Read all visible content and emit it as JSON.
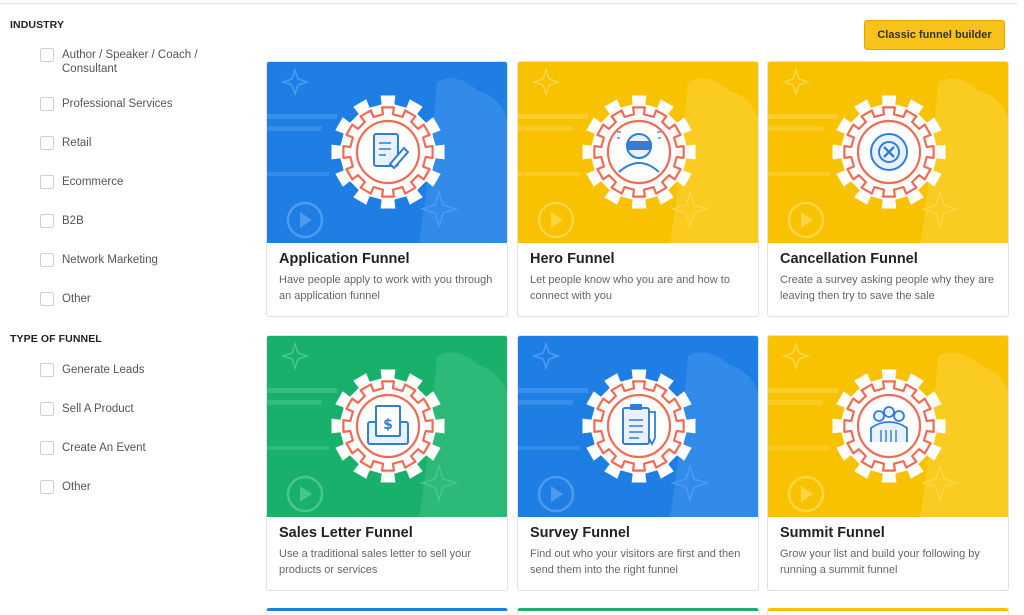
{
  "sidebar": {
    "industry_title": "INDUSTRY",
    "industry_options": [
      "Author / Speaker / Coach / Consultant",
      "Professional Services",
      "Retail",
      "Ecommerce",
      "B2B",
      "Network Marketing",
      "Other"
    ],
    "funnel_type_title": "TYPE OF FUNNEL",
    "funnel_type_options": [
      "Generate Leads",
      "Sell A Product",
      "Create An Event",
      "Other"
    ]
  },
  "classic_button_label": "Classic funnel builder",
  "colors": {
    "blue": "#1f7ee3",
    "yellow": "#f8c200",
    "green": "#18b06a",
    "badge_red": "#ef6b55",
    "icon_blue": "#2f7fd8"
  },
  "cards": [
    {
      "title": "Application Funnel",
      "description": "Have people apply to work with you through an application funnel",
      "theme": "blue",
      "icon": "document-pen-icon"
    },
    {
      "title": "Hero Funnel",
      "description": "Let people know who you are and how to connect with you",
      "theme": "yellow",
      "icon": "vr-person-icon"
    },
    {
      "title": "Cancellation Funnel",
      "description": "Create a survey asking people why they are leaving then try to save the sale",
      "theme": "yellow",
      "icon": "cancel-circle-icon"
    },
    {
      "title": "Sales Letter Funnel",
      "description": "Use a traditional sales letter to sell your products or services",
      "theme": "green",
      "icon": "sales-letter-icon"
    },
    {
      "title": "Survey Funnel",
      "description": "Find out who your visitors are first and then send them into the right funnel",
      "theme": "blue",
      "icon": "clipboard-pen-icon"
    },
    {
      "title": "Summit Funnel",
      "description": "Grow your list and build your following by running a summit funnel",
      "theme": "yellow",
      "icon": "speakers-group-icon"
    }
  ]
}
